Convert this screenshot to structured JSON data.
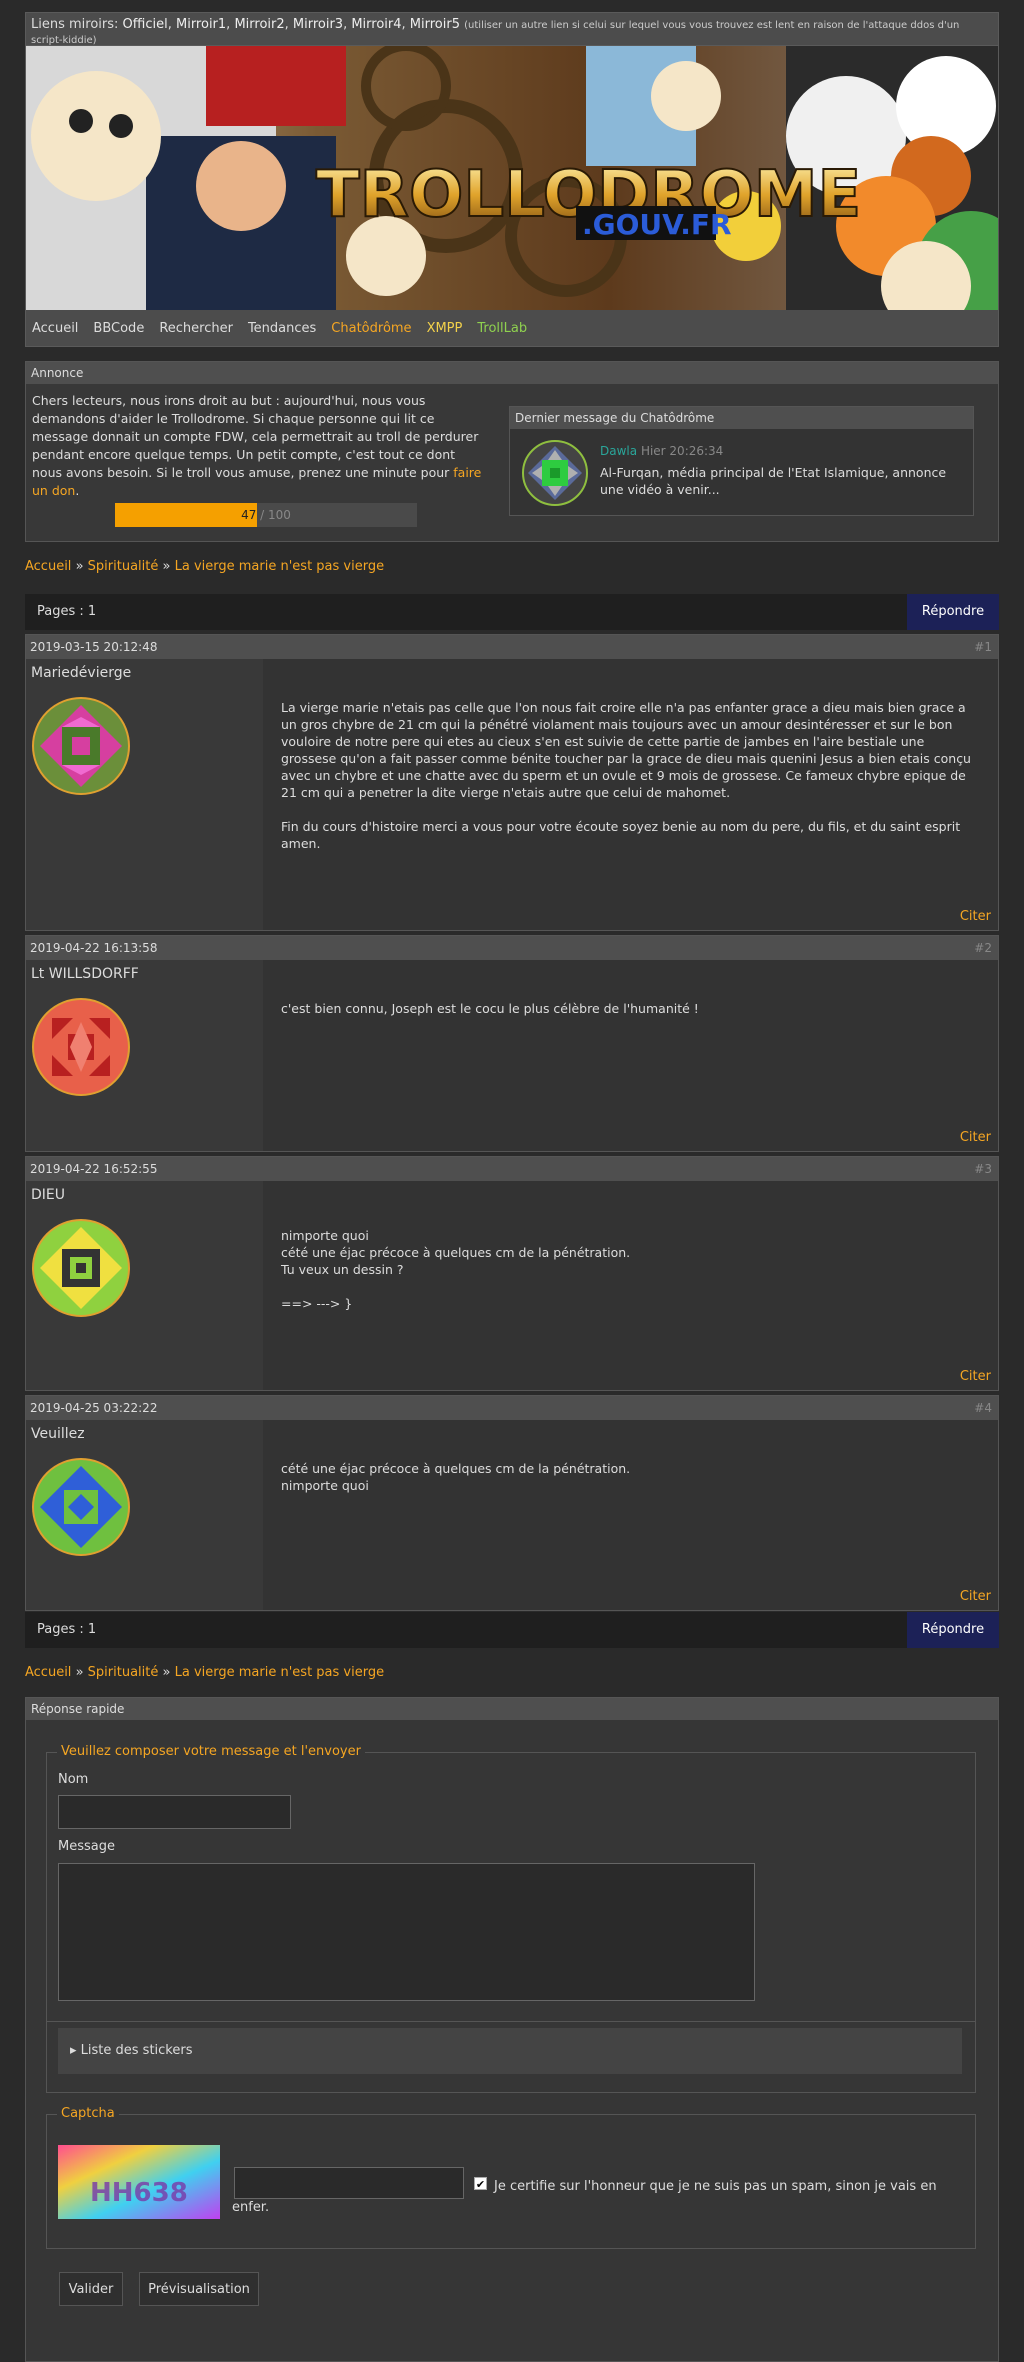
{
  "header": {
    "mirrors_label": "Liens miroirs:",
    "mirrors": [
      "Officiel",
      "Mirroir1",
      "Mirroir2",
      "Mirroir3",
      "Mirroir4",
      "Mirroir5"
    ],
    "mirrors_note": "(utiliser un autre lien si celui sur lequel vous vous trouvez est lent en raison de l'attaque ddos d'un script-kiddie)",
    "logo_text": "TROLLODROME",
    "logo_sub": ".GOUV.FR"
  },
  "nav": {
    "items": [
      "Accueil",
      "BBCode",
      "Rechercher",
      "Tendances",
      "Chatôdrôme",
      "XMPP",
      "TrollLab"
    ]
  },
  "announce": {
    "title": "Annonce",
    "text": "Chers lecteurs, nous irons droit au but : aujourd'hui, nous vous demandons d'aider le Trollodrome. Si chaque personne qui lit ce message donnait un compte FDW, cela permettrait au troll de perdurer pendant encore quelque temps. Un petit compte, c'est tout ce dont nous avons besoin. Si le troll vous amuse, prenez une minute pour",
    "donate_link": "faire un don",
    "donate_end": ".",
    "progress_current": "47",
    "progress_sep": " / ",
    "progress_total": "100",
    "progress_fraction": 0.47
  },
  "chat": {
    "title": "Dernier message du Chatôdrôme",
    "author": "Dawla",
    "time": "Hier 20:26:34",
    "message": "Al-Furqan, média principal de l'Etat Islamique, annonce une vidéo à venir..."
  },
  "breadcrumb": {
    "home": "Accueil",
    "sep": "»",
    "category": "Spiritualité",
    "topic": "La vierge marie n'est pas vierge"
  },
  "pagination": {
    "label": "Pages : 1",
    "reply_button": "Répondre"
  },
  "posts": [
    {
      "date": "2019-03-15 20:12:48",
      "num": "#1",
      "author": "Mariedévierge",
      "text": "La vierge marie n'etais pas celle que l'on nous fait croire elle n'a pas enfanter grace a dieu mais bien grace a un gros chybre de 21 cm qui la pénétré violament mais toujours avec un amour desintéresser  et sur le bon vouloire de notre pere qui etes au cieux s'en est suivie de cette partie de jambes en l'aire bestiale une grossese qu'on a fait passer comme bénite toucher par la grace de dieu mais quenini Jesus a bien etais conçu avec un chybre et une chatte avec du sperm et un ovule et 9 mois de grossese. Ce fameux chybre epique de 21 cm qui a penetrer la dite vierge n'etais autre que celui de mahomet.\n\nFin du cours d'histoire merci a vous pour votre écoute soyez benie au nom du pere, du fils, et du saint esprit amen.",
      "cite": "Citer"
    },
    {
      "date": "2019-04-22 16:13:58",
      "num": "#2",
      "author": "Lt WILLSDORFF",
      "text": "c'est bien connu, Joseph est le cocu le plus célèbre de l'humanité !",
      "cite": "Citer"
    },
    {
      "date": "2019-04-22 16:52:55",
      "num": "#3",
      "author": "DIEU",
      "text": "nimporte quoi\ncété une éjac précoce à quelques cm de la pénétration.\nTu veux un dessin ?\n\n==> ---> }",
      "cite": "Citer"
    },
    {
      "date": "2019-04-25 03:22:22",
      "num": "#4",
      "author": "Veuillez",
      "text": "cété une éjac précoce à quelques cm de la pénétration.\nnimporte quoi",
      "cite": "Citer"
    }
  ],
  "quick_reply": {
    "title": "Réponse rapide",
    "legend": "Veuillez composer votre message et l'envoyer",
    "name_label": "Nom",
    "message_label": "Message",
    "stickers": "▸ Liste des stickers",
    "captcha_legend": "Captcha",
    "captcha_text": "HH638",
    "certify": "Je certifie sur l'honneur que je ne suis pas un spam, sinon je vais en enfer.",
    "submit": "Valider",
    "preview": "Prévisualisation"
  },
  "colors": {
    "accent": "#f5a623",
    "reply_button": "#1c2157",
    "chat_author": "#2aa69a"
  }
}
